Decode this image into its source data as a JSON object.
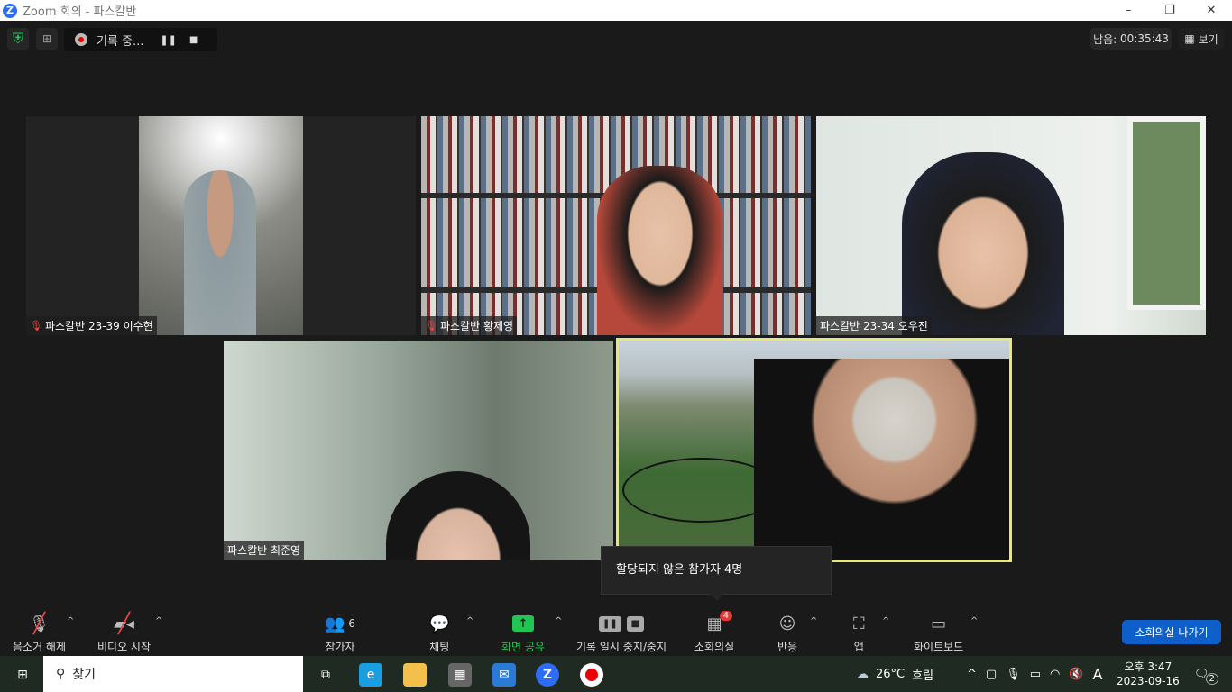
{
  "window": {
    "title": "Zoom 회의 - 파스칼반",
    "minimize": "–",
    "maximize": "❐",
    "close": "✕"
  },
  "topbar": {
    "recording_label": "기록 중...",
    "timer_label": "남음:",
    "timer_value": "00:35:43",
    "view_label": "보기"
  },
  "participants": [
    {
      "name": "파스칼반 23-39 이수현",
      "muted": true
    },
    {
      "name": "파스칼반 황제영",
      "muted": true
    },
    {
      "name": "파스칼반 23-34 오우진",
      "muted": false
    },
    {
      "name": "파스칼반 최준영",
      "muted": false
    }
  ],
  "toolbar": {
    "unmute": "음소거 해제",
    "video": "비디오 시작",
    "participants": "참가자",
    "participants_count": "6",
    "chat": "채팅",
    "share": "화면 공유",
    "record": "기록 일시 중지/중지",
    "breakout": "소회의실",
    "breakout_badge": "4",
    "reactions": "반응",
    "apps": "앱",
    "whiteboard": "화이트보드",
    "leave_breakout": "소회의실 나가기"
  },
  "tooltip": "할당되지 않은 참가자 4명",
  "taskbar": {
    "search": "찾기",
    "weather_temp": "26°C",
    "weather_desc": "흐림",
    "ime": "A",
    "time": "오후 3:47",
    "date": "2023-09-16",
    "notifications": "2"
  },
  "colors": {
    "accent": "#0e5fc9",
    "share_green": "#23c552",
    "speaker_border": "#e8e87a",
    "badge_red": "#e53935"
  }
}
